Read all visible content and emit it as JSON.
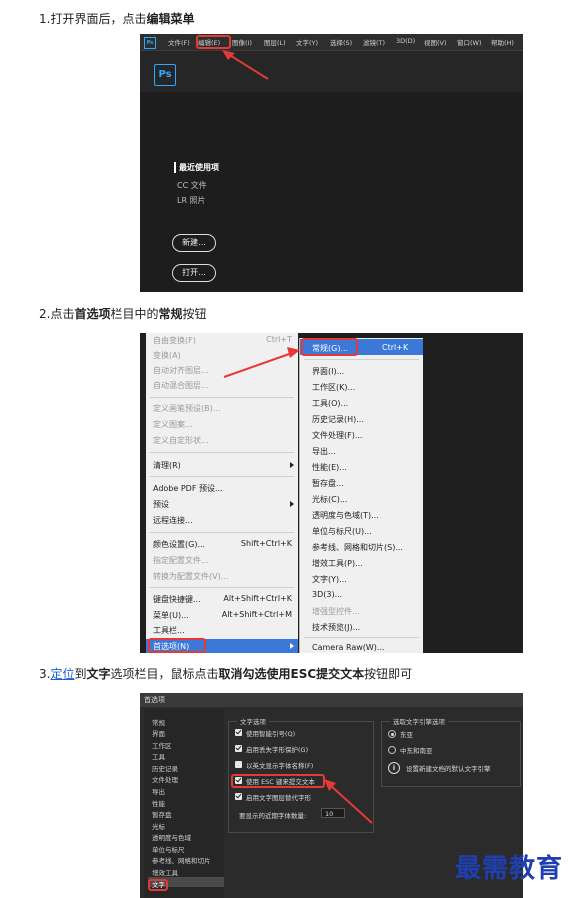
{
  "step1": {
    "prefix": "1.打开界面后，点击",
    "bold": "编辑菜单"
  },
  "step2": {
    "p1": "2.点击",
    "b1": "首选项",
    "p2": "栏目中的",
    "b2": "常规",
    "p3": "按钮"
  },
  "step3": {
    "prefix": "3.",
    "link": "定位",
    "p1": "到",
    "b1": "文字",
    "p2": "选项栏目，鼠标点击",
    "b2": "取消勾选使用ESC提交文本",
    "p3": "按钮即可"
  },
  "ps_start": {
    "logo": "Ps",
    "menu": [
      "文件(F)",
      "编辑(E)",
      "图像(I)",
      "图层(L)",
      "文字(Y)",
      "选择(S)",
      "滤镜(T)",
      "3D(D)",
      "视图(V)",
      "窗口(W)",
      "帮助(H)"
    ],
    "recent_label": "最近使用项",
    "side_items": [
      "CC 文件",
      "LR 照片"
    ],
    "new_button": "新建...",
    "open_button": "打开..."
  },
  "edit_menu": {
    "items": [
      {
        "label": "自由变换(F)",
        "shortcut": "Ctrl+T",
        "disabled": true
      },
      {
        "label": "变换(A)",
        "shortcut": "",
        "disabled": true
      },
      {
        "label": "自动对齐图层...",
        "shortcut": "",
        "disabled": true
      },
      {
        "label": "自动混合图层...",
        "shortcut": "",
        "disabled": true
      },
      {
        "label": "定义画笔预设(B)...",
        "shortcut": "",
        "disabled": true
      },
      {
        "label": "定义图案...",
        "shortcut": "",
        "disabled": true
      },
      {
        "label": "定义自定形状...",
        "shortcut": "",
        "disabled": true
      },
      {
        "label": "清理(R)",
        "shortcut": "",
        "disabled": false
      },
      {
        "label": "Adobe PDF 预设...",
        "shortcut": "",
        "disabled": false
      },
      {
        "label": "预设",
        "shortcut": "",
        "disabled": false
      },
      {
        "label": "远程连接...",
        "shortcut": "",
        "disabled": false
      },
      {
        "label": "颜色设置(G)...",
        "shortcut": "Shift+Ctrl+K",
        "disabled": false
      },
      {
        "label": "指定配置文件...",
        "shortcut": "",
        "disabled": true
      },
      {
        "label": "转换为配置文件(V)...",
        "shortcut": "",
        "disabled": true
      },
      {
        "label": "键盘快捷键...",
        "shortcut": "Alt+Shift+Ctrl+K",
        "disabled": false
      },
      {
        "label": "菜单(U)...",
        "shortcut": "Alt+Shift+Ctrl+M",
        "disabled": false
      },
      {
        "label": "工具栏...",
        "shortcut": "",
        "disabled": false
      },
      {
        "label": "首选项(N)",
        "shortcut": "",
        "disabled": false
      }
    ]
  },
  "prefs_submenu": {
    "general": {
      "label": "常规(G)...",
      "shortcut": "Ctrl+K"
    },
    "items": [
      {
        "label": "界面(I)...",
        "disabled": false
      },
      {
        "label": "工作区(K)...",
        "disabled": false
      },
      {
        "label": "工具(O)...",
        "disabled": false
      },
      {
        "label": "历史记录(H)...",
        "disabled": false
      },
      {
        "label": "文件处理(F)...",
        "disabled": false
      },
      {
        "label": "导出...",
        "disabled": false
      },
      {
        "label": "性能(E)...",
        "disabled": false
      },
      {
        "label": "暂存盘...",
        "disabled": false
      },
      {
        "label": "光标(C)...",
        "disabled": false
      },
      {
        "label": "透明度与色域(T)...",
        "disabled": false
      },
      {
        "label": "单位与标尺(U)...",
        "disabled": false
      },
      {
        "label": "参考线、网格和切片(S)...",
        "disabled": false
      },
      {
        "label": "增效工具(P)...",
        "disabled": false
      },
      {
        "label": "文字(Y)...",
        "disabled": false
      },
      {
        "label": "3D(3)...",
        "disabled": false
      },
      {
        "label": "增强型控件...",
        "disabled": true
      },
      {
        "label": "技术预览(J)...",
        "disabled": false
      },
      {
        "label": "Camera Raw(W)...",
        "disabled": false
      }
    ]
  },
  "prefs_dialog": {
    "title": "首选项",
    "nav": [
      "常规",
      "界面",
      "工作区",
      "工具",
      "历史记录",
      "文件处理",
      "导出",
      "性能",
      "暂存盘",
      "光标",
      "透明度与色域",
      "单位与标尺",
      "参考线、网格和切片",
      "增效工具",
      "文字"
    ],
    "type_group": "文字选项",
    "options": [
      {
        "label": "使用智能引号(Q)",
        "checked": true
      },
      {
        "label": "启用丢失字形保护(G)",
        "checked": true
      },
      {
        "label": "以英文显示字体名称(F)",
        "checked": false
      },
      {
        "label": "使用 ESC 键来提交文本",
        "checked": true
      },
      {
        "label": "启用文字图层替代字形",
        "checked": true
      }
    ],
    "recent_fonts_label": "要显示的近期字体数量:",
    "recent_fonts_value": "10",
    "engine_group": "选取文字引擎选项",
    "engines": [
      {
        "label": "东亚",
        "selected": true
      },
      {
        "label": "中东和南亚",
        "selected": false
      }
    ],
    "engine_note": "设置新建文档的默认文字引擎"
  },
  "watermark": "最需教育",
  "colors": {
    "accent": "#3b78d8",
    "highlight": "#e53935",
    "ps_blue": "#31a8ff",
    "watermark": "#1f3fae"
  }
}
